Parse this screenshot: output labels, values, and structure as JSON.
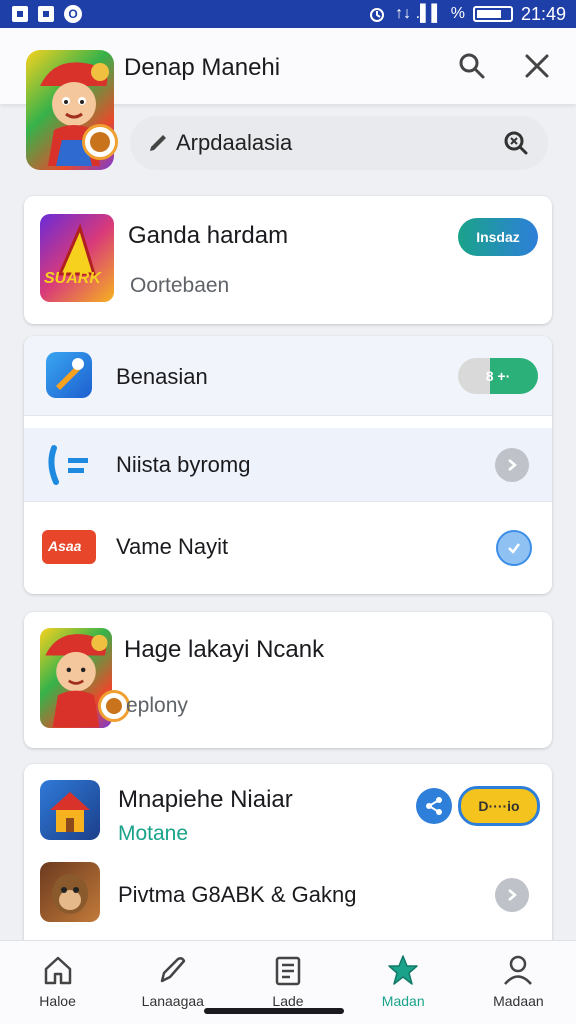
{
  "status_bar": {
    "time": "21:49",
    "signal_glyph": "↑↓ .▌▌",
    "percent_glyph": "%"
  },
  "header": {
    "title": "Denap Manehi",
    "search_icon": "search-icon",
    "close_icon": "close-icon"
  },
  "search": {
    "value": "Arpdaalasia",
    "icon_left": "pencil-icon",
    "icon_right": "clear-search-icon"
  },
  "featured": {
    "title": "Ganda hardam",
    "subtitle": "Oortebaen",
    "icon_text": "SUARK",
    "action_label": "Insdaz"
  },
  "list": [
    {
      "title": "Benasian",
      "action": "8  +·"
    },
    {
      "title": "Niista byromg"
    },
    {
      "title": "Vame Nayit",
      "icon_text": "Asaa"
    }
  ],
  "promo": {
    "title": "Hage lakayi Ncank",
    "subtitle": "eplony"
  },
  "bottom_card": {
    "title": "Mnapiehe Niaiar",
    "subtitle": "Motane",
    "action_label": "D····io",
    "row2_title": "Pivtma G8ABK &  Gakng"
  },
  "nav": [
    {
      "label": "Haloe",
      "icon": "home-icon"
    },
    {
      "label": "Lanaagaa",
      "icon": "pen-icon"
    },
    {
      "label": "Lade",
      "icon": "clipboard-icon"
    },
    {
      "label": "Madan",
      "icon": "star-icon",
      "active": true
    },
    {
      "label": "Madaan",
      "icon": "profile-icon"
    }
  ],
  "colors": {
    "status_bar": "#1f3fa8",
    "accent": "#1aa38a",
    "toggle_blue": "#2e7fd9",
    "toggle_yellow": "#f4c31d"
  }
}
